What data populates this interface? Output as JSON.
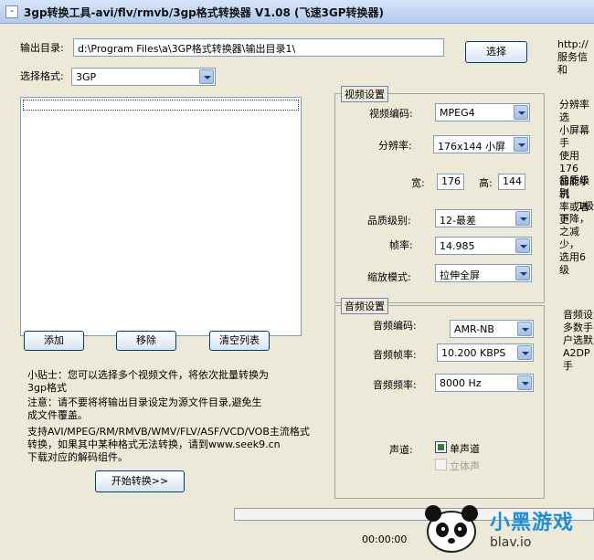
{
  "window": {
    "title": "3gp转换工具-avi/flv/rmvb/3gp格式转换器 V1.08 (飞速3GP转换器)",
    "sys_menu": "-"
  },
  "output": {
    "label": "输出目录:",
    "path": "d:\\Program Files\\a\\3GP格式转换器\\输出目录1\\",
    "browse": "选择"
  },
  "format": {
    "label": "选择格式:",
    "value": "3GP"
  },
  "right_notes": {
    "n1": [
      "http://",
      "服务信和"
    ],
    "n2": [
      "分辨率选",
      "小屏幕手",
      "使用176",
      "智能手机",
      "率或者更"
    ],
    "n3": [
      "品质级别",
      "1级",
      "下降，",
      "之减少，",
      "选用6级"
    ],
    "n4": [
      "音频设",
      "多数手",
      "户选默",
      "A2DP手"
    ]
  },
  "file_buttons": {
    "add": "添加",
    "remove": "移除",
    "clear": "清空列表"
  },
  "tips": {
    "t1": [
      "小贴士：您可以选择多个视频文件，将依次批量转换为",
      "3gp格式"
    ],
    "t2": [
      "注意：请不要将将输出目录设定为源文件目录,避免生",
      "成文件覆盖。"
    ],
    "t3": [
      "支持AVI/MPEG/RM/RMVB/WMV/FLV/ASF/VCD/VOB主流格式",
      "转换，如果其中某种格式无法转换，请到www.seek9.cn",
      "下载对应的解码组件。"
    ]
  },
  "start_button": "开始转换>>",
  "video": {
    "group_title": "视频设置",
    "codec_label": "视频编码:",
    "codec": "MPEG4",
    "res_label": "分辨率:",
    "res": "176x144 小屏",
    "width_label": "宽:",
    "width": "176",
    "height_label": "高:",
    "height": "144",
    "quality_label": "品质级别:",
    "quality": "12-最差",
    "fps_label": "帧率:",
    "fps": "14.985",
    "scale_label": "缩放模式:",
    "scale": "拉伸全屏"
  },
  "audio": {
    "group_title": "音频设置",
    "codec_label": "音频编码:",
    "codec": "AMR-NB",
    "bitrate_label": "音频帧率:",
    "bitrate": "10.200 KBPS",
    "freq_label": "音频频率:",
    "freq": "8000 Hz",
    "channel_label": "声道:",
    "mono": "单声道",
    "stereo": "立体声"
  },
  "status": {
    "time": "00:00:00",
    "site": "blav.io",
    "watermark": "小黑游戏"
  }
}
